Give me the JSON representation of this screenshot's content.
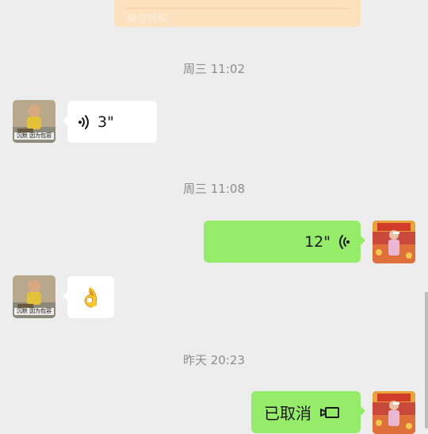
{
  "transfer": {
    "label": "微信转账"
  },
  "messages": {
    "ts1": "周三 11:02",
    "voice_in_duration": "3\"",
    "ts2": "周三 11:08",
    "voice_out_duration": "12\"",
    "emoji_ok": "👌",
    "ts3": "昨天 20:23",
    "call_status": "已取消"
  },
  "avatars": {
    "contact_caption": "沉默 因为包容"
  },
  "icons": {
    "voice_in": "voice-wave-icon",
    "voice_out": "voice-wave-icon",
    "call": "video-call-icon"
  },
  "colors": {
    "background": "#ededed",
    "bubble_in": "#ffffff",
    "bubble_out": "#95ec69",
    "timestamp": "#8d8d8d",
    "transfer_card": "#fce1bf"
  }
}
